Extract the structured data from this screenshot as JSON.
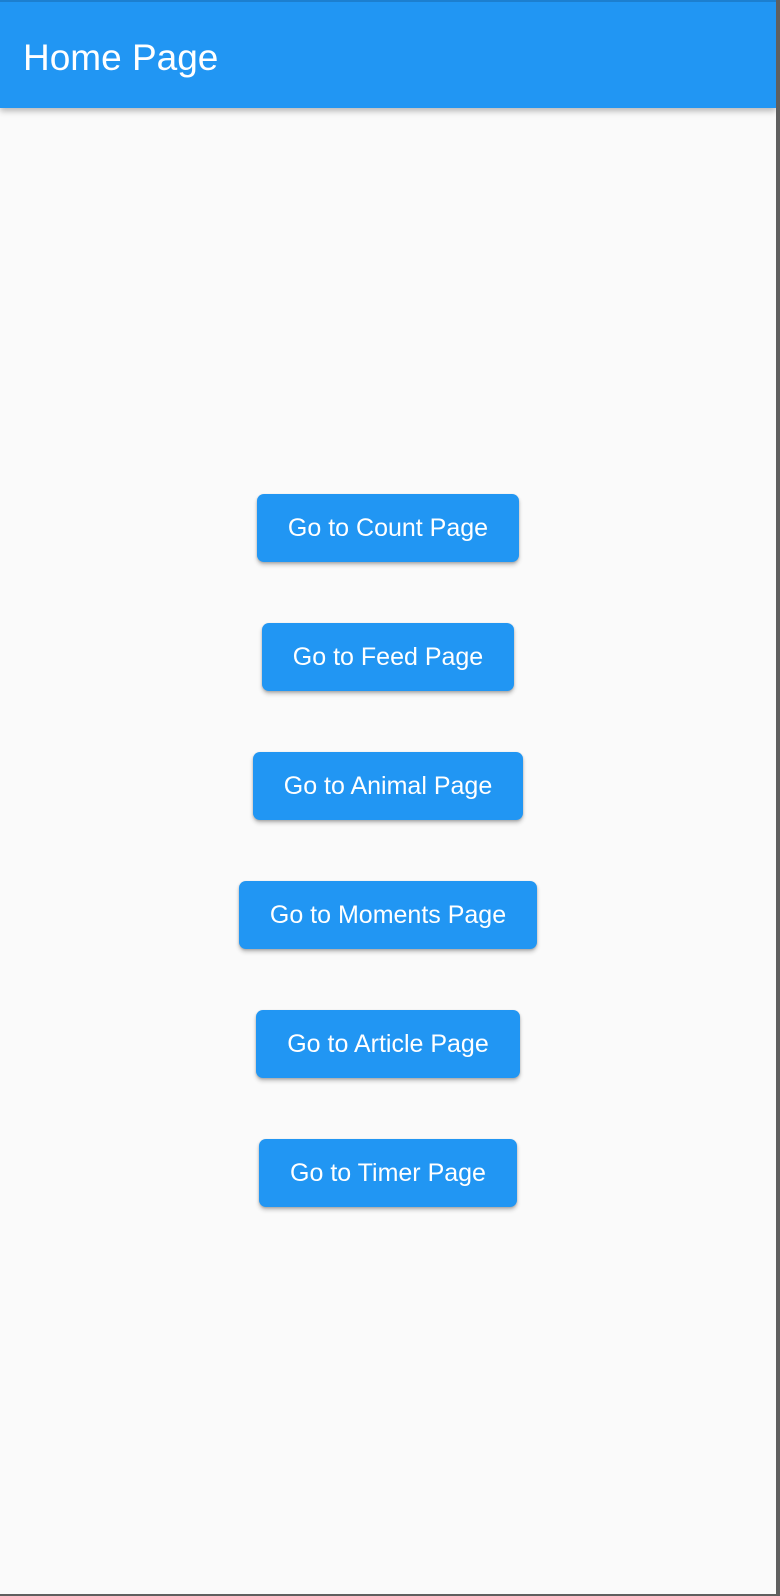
{
  "app_bar": {
    "title": "Home Page",
    "color": "#2196f3"
  },
  "buttons": [
    {
      "label": "Go to Count Page"
    },
    {
      "label": "Go to Feed Page"
    },
    {
      "label": "Go to Animal Page"
    },
    {
      "label": "Go to Moments Page"
    },
    {
      "label": "Go to Article Page"
    },
    {
      "label": "Go to Timer Page"
    }
  ]
}
